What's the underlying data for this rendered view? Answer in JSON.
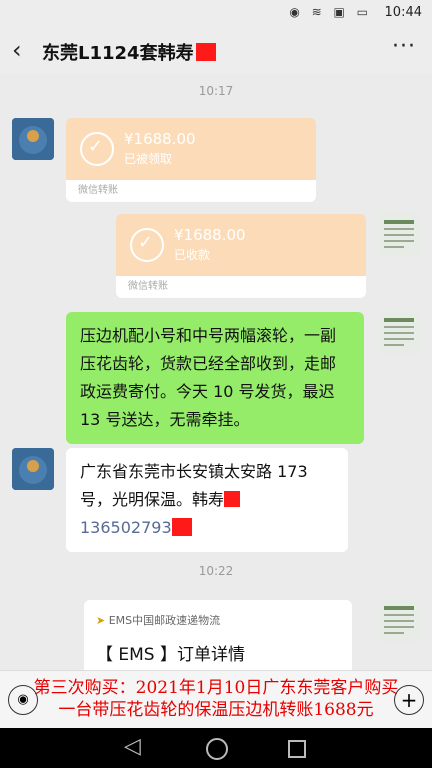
{
  "status": {
    "time": "10:44",
    "icons": [
      "eye-icon",
      "wifi-icon",
      "sim-icon",
      "battery-icon"
    ]
  },
  "header": {
    "title": "东莞L1124套韩寿",
    "back": "‹",
    "more": "···"
  },
  "timestamps": [
    "10:17",
    "10:22"
  ],
  "transfers": [
    {
      "amount": "¥1688.00",
      "state": "已被领取",
      "footer": "微信转账"
    },
    {
      "amount": "¥1688.00",
      "state": "已收款",
      "footer": "微信转账"
    }
  ],
  "messages": [
    {
      "text": "压边机配小号和中号两幅滚轮，一副压花齿轮，货款已经全部收到，走邮政运费寄付。今天 10 号发货，最迟 13 号送达，无需牵挂。"
    },
    {
      "text1": "广东省东莞市长安镇太安路 173 号，光明保温。韩寿",
      "phone": "136502793"
    }
  ],
  "ems": {
    "logo": "EMS中国邮政速递物流",
    "title": "【 EMS 】订单详情"
  },
  "caption": {
    "line1": "第三次购买：2021年1月10日广东东莞客户购买",
    "line2": "一台带压花齿轮的保温压边机转账1688元"
  },
  "colors": {
    "green_bubble": "#95ec69",
    "transfer": "#fcdcb8",
    "caption_red": "#e60000"
  }
}
